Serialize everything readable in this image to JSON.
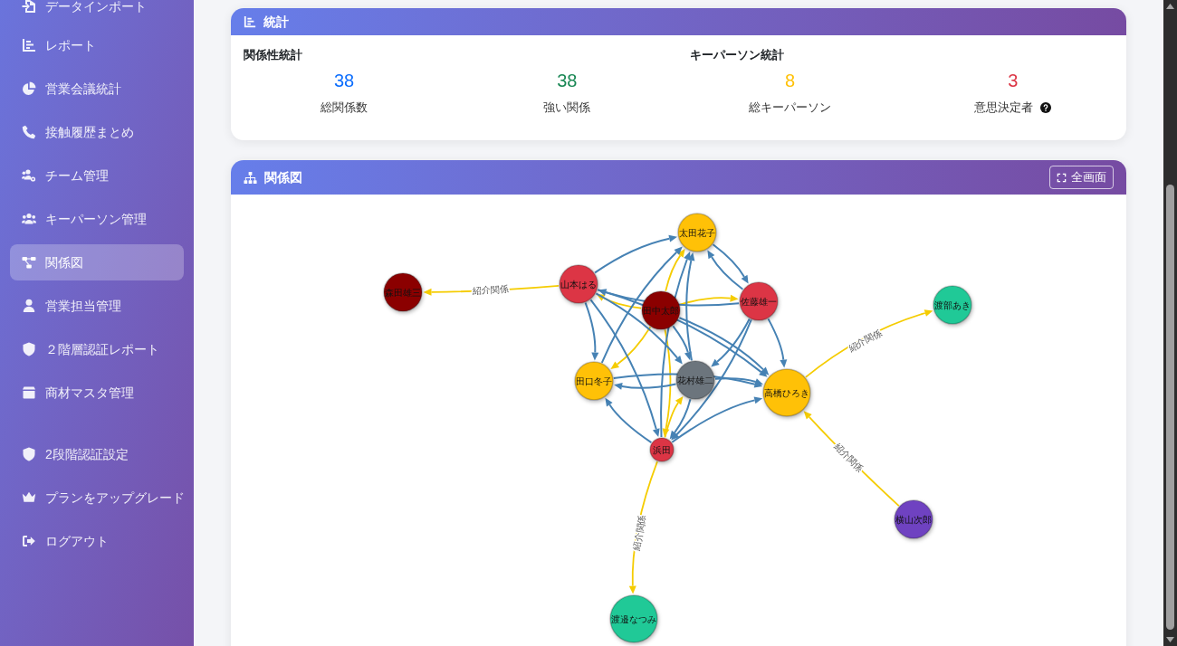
{
  "sidebar": {
    "items": [
      {
        "label": "データインポート",
        "selected": false
      },
      {
        "label": "レポート",
        "selected": false
      },
      {
        "label": "営業会議統計",
        "selected": false
      },
      {
        "label": "接触履歴まとめ",
        "selected": false
      },
      {
        "label": "チーム管理",
        "selected": false
      },
      {
        "label": "キーパーソン管理",
        "selected": false
      },
      {
        "label": "関係図",
        "selected": true
      },
      {
        "label": "営業担当管理",
        "selected": false
      },
      {
        "label": "２階層認証レポート",
        "selected": false
      },
      {
        "label": "商材マスタ管理",
        "selected": false
      }
    ],
    "account_items": [
      {
        "label": "2段階認証設定",
        "selected": false
      },
      {
        "label": "プランをアップグレード",
        "selected": false
      },
      {
        "label": "ログアウト",
        "selected": false
      }
    ]
  },
  "stats_panel": {
    "title": "統計",
    "groups": [
      {
        "title": "関係性統計",
        "stats": [
          {
            "value": "38",
            "label": "総関係数",
            "color": "#0d6efd",
            "help": false
          },
          {
            "value": "38",
            "label": "強い関係",
            "color": "#198754",
            "help": false
          }
        ]
      },
      {
        "title": "キーパーソン統計",
        "stats": [
          {
            "value": "8",
            "label": "総キーパーソン",
            "color": "#ffc107",
            "help": false
          },
          {
            "value": "3",
            "label": "意思決定者",
            "color": "#dc3545",
            "help": true
          }
        ]
      }
    ]
  },
  "relationship_map": {
    "title": "関係図",
    "fullscreen_button": "全画面",
    "nodes": [
      {
        "name": "太田花子",
        "color": "#ffc107",
        "kind": "regular"
      },
      {
        "name": "山本はる",
        "color": "#dc3545",
        "kind": "regular"
      },
      {
        "name": "森田雄三",
        "color": "#8b0000",
        "kind": "regular"
      },
      {
        "name": "佐藤雄一",
        "color": "#dc3545",
        "kind": "regular"
      },
      {
        "name": "渡部あき",
        "color": "#20c997",
        "kind": "regular"
      },
      {
        "name": "田中太郎",
        "color": "#8b0000",
        "kind": "regular"
      },
      {
        "name": "花村雄二",
        "color": "#6c757d",
        "kind": "regular"
      },
      {
        "name": "田口冬子",
        "color": "#ffc107",
        "kind": "regular"
      },
      {
        "name": "高橋ひろき",
        "color": "#ffc107",
        "kind": "major"
      },
      {
        "name": "浜田",
        "color": "#dc3545",
        "kind": "minor"
      },
      {
        "name": "横山次郎",
        "color": "#6f42c1",
        "kind": "regular"
      },
      {
        "name": "渡邉なつみ",
        "color": "#20c997",
        "kind": "major"
      }
    ],
    "edges": [
      {
        "kind": "referral",
        "label": "紹介関係"
      },
      {
        "kind": "referral"
      },
      {
        "kind": "referral"
      },
      {
        "kind": "referral"
      },
      {
        "kind": "referral"
      },
      {
        "kind": "referral"
      },
      {
        "kind": "referral"
      },
      {
        "kind": "referral",
        "label": "紹介関係"
      },
      {
        "kind": "referral",
        "label": "紹介関係"
      },
      {
        "kind": "referral",
        "label": "紹介関係"
      },
      {
        "kind": "colleague"
      },
      {
        "kind": "colleague"
      },
      {
        "kind": "colleague"
      },
      {
        "kind": "colleague"
      },
      {
        "kind": "colleague"
      },
      {
        "kind": "colleague"
      },
      {
        "kind": "colleague"
      },
      {
        "kind": "colleague"
      },
      {
        "kind": "colleague"
      },
      {
        "kind": "colleague"
      },
      {
        "kind": "colleague"
      },
      {
        "kind": "colleague"
      },
      {
        "kind": "colleague"
      },
      {
        "kind": "colleague"
      },
      {
        "kind": "colleague"
      },
      {
        "kind": "colleague"
      },
      {
        "kind": "colleague"
      },
      {
        "kind": "colleague"
      },
      {
        "kind": "colleague"
      },
      {
        "kind": "colleague"
      },
      {
        "kind": "colleague"
      },
      {
        "kind": "colleague"
      }
    ]
  }
}
